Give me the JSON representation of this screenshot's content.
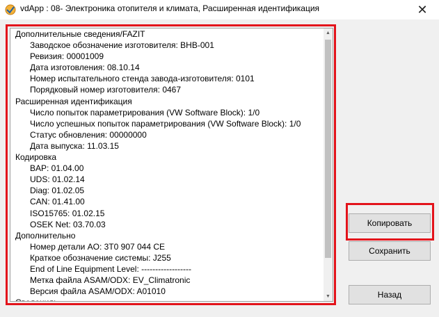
{
  "window": {
    "title": "vdApp : 08- Электроника отопителя и климата,  Расширенная идентификация",
    "close_glyph": "✕",
    "icon": "vdapp-logo-icon"
  },
  "info": {
    "lines": [
      {
        "level": "h",
        "text": "Дополнительные сведения/FAZIT"
      },
      {
        "level": "i",
        "text": "Заводское обозначение изготовителя: BHB-001"
      },
      {
        "level": "i",
        "text": "Ревизия: 00001009"
      },
      {
        "level": "i",
        "text": "Дата изготовления: 08.10.14"
      },
      {
        "level": "i",
        "text": "Номер испытательного стенда завода-изготовителя: 0101"
      },
      {
        "level": "i",
        "text": "Порядковый номер изготовителя: 0467"
      },
      {
        "level": "h",
        "text": "Расширенная идентификация"
      },
      {
        "level": "i",
        "text": "Число попыток параметрирования (VW Software Block): 1/0"
      },
      {
        "level": "i",
        "text": "Число успешных попыток параметрирования (VW Software Block): 1/0"
      },
      {
        "level": "i",
        "text": "Статус обновления: 00000000"
      },
      {
        "level": "i",
        "text": "Дата выпуска: 11.03.15"
      },
      {
        "level": "h",
        "text": "Кодировка"
      },
      {
        "level": "i",
        "text": "BAP: 01.04.00"
      },
      {
        "level": "i",
        "text": "UDS: 01.02.14"
      },
      {
        "level": "i",
        "text": "Diag: 01.02.05"
      },
      {
        "level": "i",
        "text": "CAN: 01.41.00"
      },
      {
        "level": "i",
        "text": "ISO15765: 01.02.15"
      },
      {
        "level": "i",
        "text": "OSEK Net: 03.70.03"
      },
      {
        "level": "h",
        "text": "Дополнительно"
      },
      {
        "level": "i",
        "text": "Номер детали AO: 3T0 907 044 CE"
      },
      {
        "level": "i",
        "text": "Краткое обозначение системы: J255"
      },
      {
        "level": "i",
        "text": "End of Line Equipment Level: ------------------"
      },
      {
        "level": "i",
        "text": "Метка файла ASAM/ODX: EV_Climatronic"
      },
      {
        "level": "i",
        "text": "Версия файла ASAM/ODX: A01010"
      },
      {
        "level": "h",
        "text": "Сведения:"
      }
    ]
  },
  "buttons": {
    "copy": "Копировать",
    "save": "Сохранить",
    "back": "Назад"
  },
  "colors": {
    "highlight": "#e3131b",
    "window_bg": "#f0f0f0",
    "button_bg": "#e1e1e1"
  }
}
